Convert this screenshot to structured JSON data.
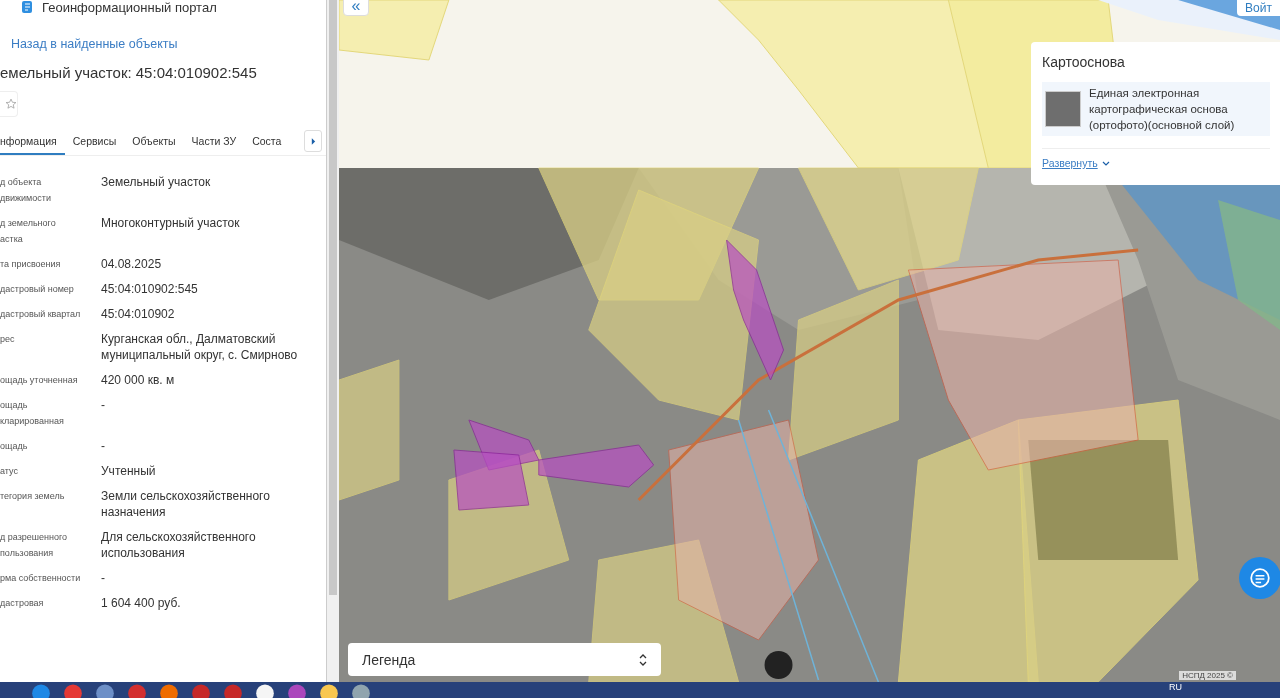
{
  "header": {
    "title": "Геоинформационный портал",
    "login_button": "Войт"
  },
  "back_link": "Назад в найденные объекты",
  "object_title": "емельный участок: 45:04:010902:545",
  "favorite": {
    "selected": false
  },
  "tabs": [
    {
      "label": "нформация",
      "selected": true
    },
    {
      "label": "Сервисы",
      "selected": false
    },
    {
      "label": "Объекты",
      "selected": false
    },
    {
      "label": "Части ЗУ",
      "selected": false
    },
    {
      "label": "Соста",
      "selected": false
    }
  ],
  "fields": [
    {
      "label": "д объекта\nдвижимости",
      "value": "Земельный участок"
    },
    {
      "label": "д земельного\nастка",
      "value": "Многоконтурный участок"
    },
    {
      "label": "та присвоения",
      "value": "04.08.2025"
    },
    {
      "label": "дастровый номер",
      "value": "45:04:010902:545"
    },
    {
      "label": "дастровый квартал",
      "value": "45:04:010902"
    },
    {
      "label": "рес",
      "value": "Курганская обл., Далматовский муниципальный округ, с. Смирново"
    },
    {
      "label": "ощадь уточненная",
      "value": "420 000 кв. м"
    },
    {
      "label": "ощадь\nкларированная",
      "value": "-"
    },
    {
      "label": "ощадь",
      "value": "-"
    },
    {
      "label": "атус",
      "value": "Учтенный"
    },
    {
      "label": "тегория земель",
      "value": "Земли сельскохозяйственного назначения"
    },
    {
      "label": "д разрешенного\nпользования",
      "value": "Для сельскохозяйственного использования"
    },
    {
      "label": "рма собственности",
      "value": "-"
    },
    {
      "label": "дастровая",
      "value": "1 604 400 руб."
    }
  ],
  "map": {
    "collapse_button": "«",
    "basemap_card": {
      "title": "Картооснова",
      "layer": "Единая электронная картографическая основа (ортофото)(основной слой)",
      "expand_link": "Развернуть"
    },
    "legend": "Легенда",
    "attribution": "НСПД 2025 ©"
  },
  "taskbar": {
    "language": "RU"
  }
}
